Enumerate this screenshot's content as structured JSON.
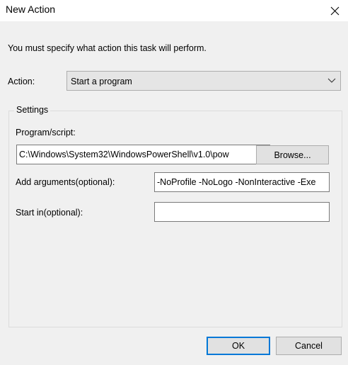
{
  "window": {
    "title": "New Action",
    "close_icon": "close-icon"
  },
  "dialog": {
    "intro_text": "You must specify what action this task will perform.",
    "action": {
      "label": "Action:",
      "selected": "Start a program"
    },
    "settings": {
      "title": "Settings",
      "program_script": {
        "label": "Program/script:",
        "value": "C:\\Windows\\System32\\WindowsPowerShell\\v1.0\\pow",
        "browse_label": "Browse..."
      },
      "arguments": {
        "label": "Add arguments(optional):",
        "value": "-NoProfile -NoLogo -NonInteractive -Exe"
      },
      "start_in": {
        "label": "Start in(optional):",
        "value": ""
      }
    },
    "buttons": {
      "ok": "OK",
      "cancel": "Cancel"
    }
  },
  "colors": {
    "accent": "#0078d7",
    "dialog_bg": "#f0f0f0"
  }
}
